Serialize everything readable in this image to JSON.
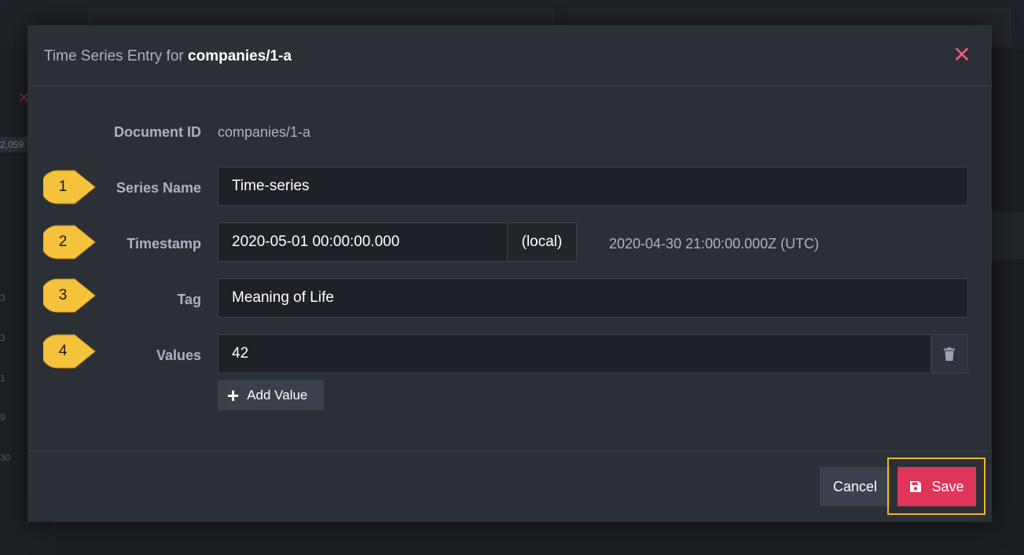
{
  "modal": {
    "title_prefix": "Time Series Entry for",
    "title_document": "companies/1-a"
  },
  "form": {
    "document_id_label": "Document ID",
    "document_id_value": "companies/1-a",
    "series_name_label": "Series Name",
    "series_name_value": "Time-series",
    "timestamp_label": "Timestamp",
    "timestamp_value": "2020-05-01 00:00:00.000",
    "timestamp_zone": "(local)",
    "timestamp_utc": "2020-04-30 21:00:00.000Z (UTC)",
    "tag_label": "Tag",
    "tag_value": "Meaning of Life",
    "values_label": "Values",
    "values": [
      "42"
    ],
    "add_value_label": "Add Value"
  },
  "footer": {
    "cancel_label": "Cancel",
    "save_label": "Save"
  },
  "callouts": [
    "1",
    "2",
    "3",
    "4"
  ],
  "background": {
    "badge": "2,059",
    "numbers": [
      "3",
      "3",
      "1",
      "9",
      "30"
    ]
  },
  "colors": {
    "accent_save": "#e0345a",
    "close": "#ee5a78",
    "highlight": "#f0b429",
    "callout": "#f5c23c"
  }
}
